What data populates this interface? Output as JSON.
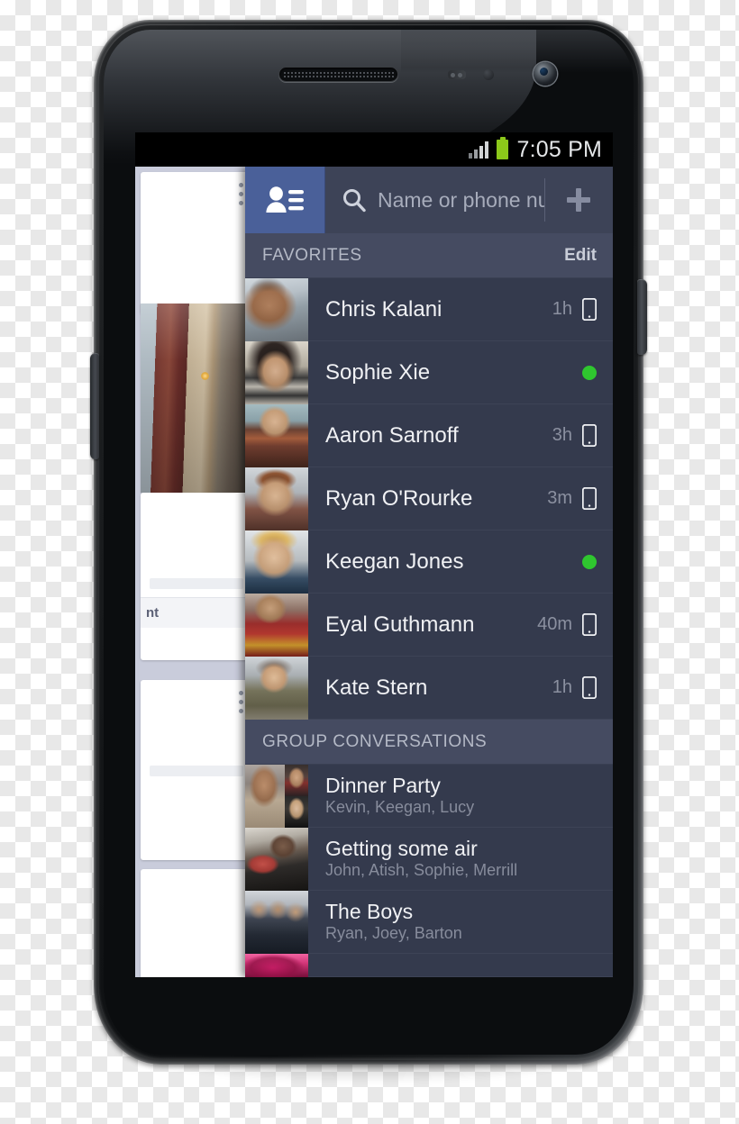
{
  "status_bar": {
    "time": "7:05 PM",
    "signal_icon": "signal-bars-icon",
    "battery_icon": "battery-icon",
    "battery_color": "#8cc81a"
  },
  "header": {
    "contacts_tab_icon": "contacts-card-icon",
    "search_icon": "search-icon",
    "search_value": "",
    "search_placeholder": "Name or phone number",
    "add_icon": "plus-icon",
    "tab_accent_color": "#4a6099",
    "bar_color": "#3d4357"
  },
  "sections": [
    {
      "title": "FAVORITES",
      "action_label": "Edit",
      "rows": [
        {
          "name": "Chris Kalani",
          "timestamp": "1h",
          "status_icon": "mobile-phone-icon",
          "avatar": "ph-chris"
        },
        {
          "name": "Sophie Xie",
          "timestamp": "",
          "status_icon": "online-dot",
          "avatar": "ph-sophie"
        },
        {
          "name": "Aaron Sarnoff",
          "timestamp": "3h",
          "status_icon": "mobile-phone-icon",
          "avatar": "ph-aaron"
        },
        {
          "name": "Ryan O'Rourke",
          "timestamp": "3m",
          "status_icon": "mobile-phone-icon",
          "avatar": "ph-ryan"
        },
        {
          "name": "Keegan Jones",
          "timestamp": "",
          "status_icon": "online-dot",
          "avatar": "ph-keegan"
        },
        {
          "name": "Eyal Guthmann",
          "timestamp": "40m",
          "status_icon": "mobile-phone-icon",
          "avatar": "ph-eyal"
        },
        {
          "name": "Kate Stern",
          "timestamp": "1h",
          "status_icon": "mobile-phone-icon",
          "avatar": "ph-kate"
        }
      ]
    },
    {
      "title": "GROUP CONVERSATIONS",
      "action_label": "",
      "groups": [
        {
          "title": "Dinner Party",
          "members": "Kevin, Keegan, Lucy",
          "avatar": "composite"
        },
        {
          "title": "Getting some air",
          "members": "John, Atish, Sophie, Merrill",
          "avatar": "ph-air"
        },
        {
          "title": "The Boys",
          "members": "Ryan, Joey, Barton",
          "avatar": "ph-boys"
        }
      ]
    }
  ],
  "online_dot_color": "#2fc62f",
  "background_app": {
    "comment_label": "nt"
  }
}
